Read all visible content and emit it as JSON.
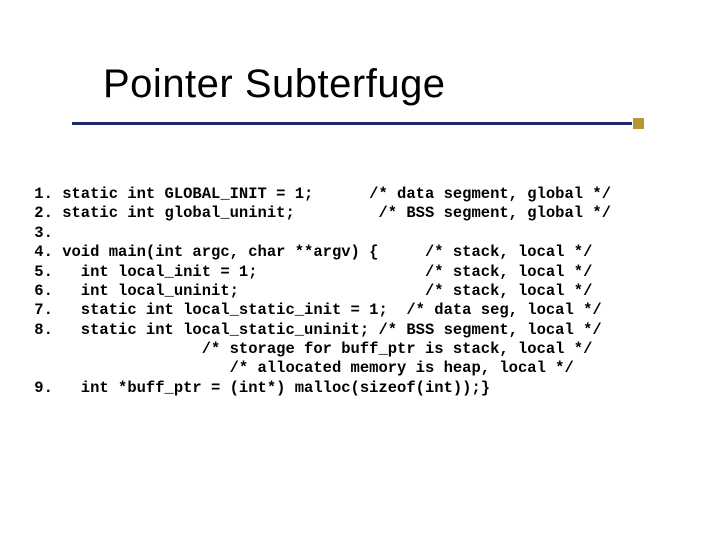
{
  "title": "Pointer Subterfuge",
  "code_lines": [
    " 1. static int GLOBAL_INIT = 1;      /* data segment, global */",
    " 2. static int global_uninit;         /* BSS segment, global */",
    " 3. ",
    " 4. void main(int argc, char **argv) {     /* stack, local */",
    " 5.   int local_init = 1;                  /* stack, local */",
    " 6.   int local_uninit;                    /* stack, local */",
    " 7.   static int local_static_init = 1;  /* data seg, local */",
    " 8.   static int local_static_uninit; /* BSS segment, local */",
    "                   /* storage for buff_ptr is stack, local */",
    "                      /* allocated memory is heap, local */",
    " 9.   int *buff_ptr = (int*) malloc(sizeof(int));}"
  ]
}
